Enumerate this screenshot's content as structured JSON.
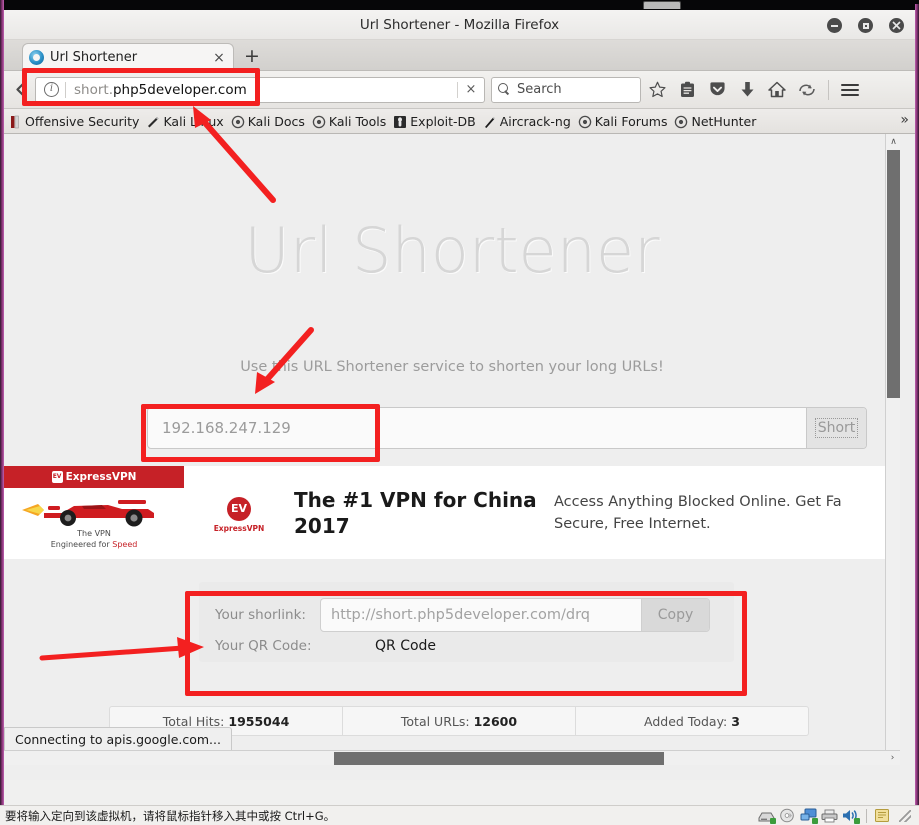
{
  "window": {
    "title": "Url Shortener - Mozilla Firefox",
    "minimize_label": "Minimize",
    "maximize_label": "Maximize",
    "close_label": "Close"
  },
  "browser": {
    "tab": {
      "label": "Url Shortener",
      "close_label": "×",
      "favicon_name": "page-favicon"
    },
    "new_tab_label": "+",
    "back_label": "◀",
    "urlbar": {
      "identity_glyph": "i",
      "url_dim": "short.",
      "url_bold": "php5developer.com",
      "clear_label": "×"
    },
    "search": {
      "placeholder": "Search"
    },
    "toolbar_icons": [
      {
        "name": "bookmark-star-icon",
        "glyph": "☆"
      },
      {
        "name": "library-icon",
        "glyph": "὜2"
      },
      {
        "name": "pocket-icon",
        "glyph": "▼"
      },
      {
        "name": "downloads-icon",
        "glyph": "⬇"
      },
      {
        "name": "home-icon",
        "glyph": "⌂"
      },
      {
        "name": "sync-icon",
        "glyph": "↺"
      },
      {
        "name": "hamburger-menu-icon",
        "glyph": "≡"
      }
    ],
    "bookmarks": [
      {
        "label": "Offensive Security",
        "icon": "offsec-icon"
      },
      {
        "label": "Kali Linux",
        "icon": "kali-linux-icon"
      },
      {
        "label": "Kali Docs",
        "icon": "kali-docs-icon"
      },
      {
        "label": "Kali Tools",
        "icon": "kali-tools-icon"
      },
      {
        "label": "Exploit-DB",
        "icon": "exploit-db-icon"
      },
      {
        "label": "Aircrack-ng",
        "icon": "aircrack-icon"
      },
      {
        "label": "Kali Forums",
        "icon": "kali-forums-icon"
      },
      {
        "label": "NetHunter",
        "icon": "nethunter-icon"
      }
    ],
    "bookmarks_overflow_label": "»",
    "status_popup": "Connecting to apis.google.com..."
  },
  "page": {
    "heading": "Url Shortener",
    "subheading": "Use this URL Shortener service to shorten your long URLs!",
    "url_input_value": "192.168.247.129",
    "url_input_placeholder": "192.168.247.129",
    "shorten_button_label": "Short",
    "ad": {
      "brand": "ExpressVPN",
      "logo_initials": "EV",
      "logo_caption": "ExpressVPN",
      "tagline_line1": "The VPN",
      "tagline_line2_prefix": "Engineered for ",
      "tagline_line2_accent": "Speed",
      "headline": "The #1 VPN for China 2017",
      "body": "Access Anything Blocked Online. Get Fa Secure, Free Internet."
    },
    "result": {
      "shorlink_label": "Your shorlink:",
      "shorlink_value": "http://short.php5developer.com/drq",
      "shorlink_placeholder": "http://short.php5developer.com/drq",
      "copy_button_label": "Copy",
      "qr_label": "Your QR Code:",
      "qr_value": "QR Code"
    },
    "stats": [
      {
        "label": "Total Hits:",
        "value": "1955044"
      },
      {
        "label": "Total URLs:",
        "value": "12600"
      },
      {
        "label": "Added Today:",
        "value": "3"
      }
    ]
  },
  "vmware": {
    "status_text": "要将输入定向到该虚拟机，请将鼠标指针移入其中或按 Ctrl+G。",
    "device_icons": [
      "hard-disk-icon",
      "cd-drive-icon",
      "network-adapter-icon",
      "printer-icon",
      "sound-card-icon",
      "usb-device-icon"
    ]
  },
  "annotations": {
    "accent_color": "#f32020",
    "boxes": [
      "urlbar-highlight",
      "url-input-highlight",
      "result-box-highlight"
    ],
    "arrows": [
      "arrow-to-urlbar",
      "arrow-to-url-input",
      "arrow-to-result-box"
    ]
  },
  "scrollbars": {
    "vertical_up_label": "∧",
    "vertical_down_label": "∨",
    "horizontal_right_label": "›"
  }
}
